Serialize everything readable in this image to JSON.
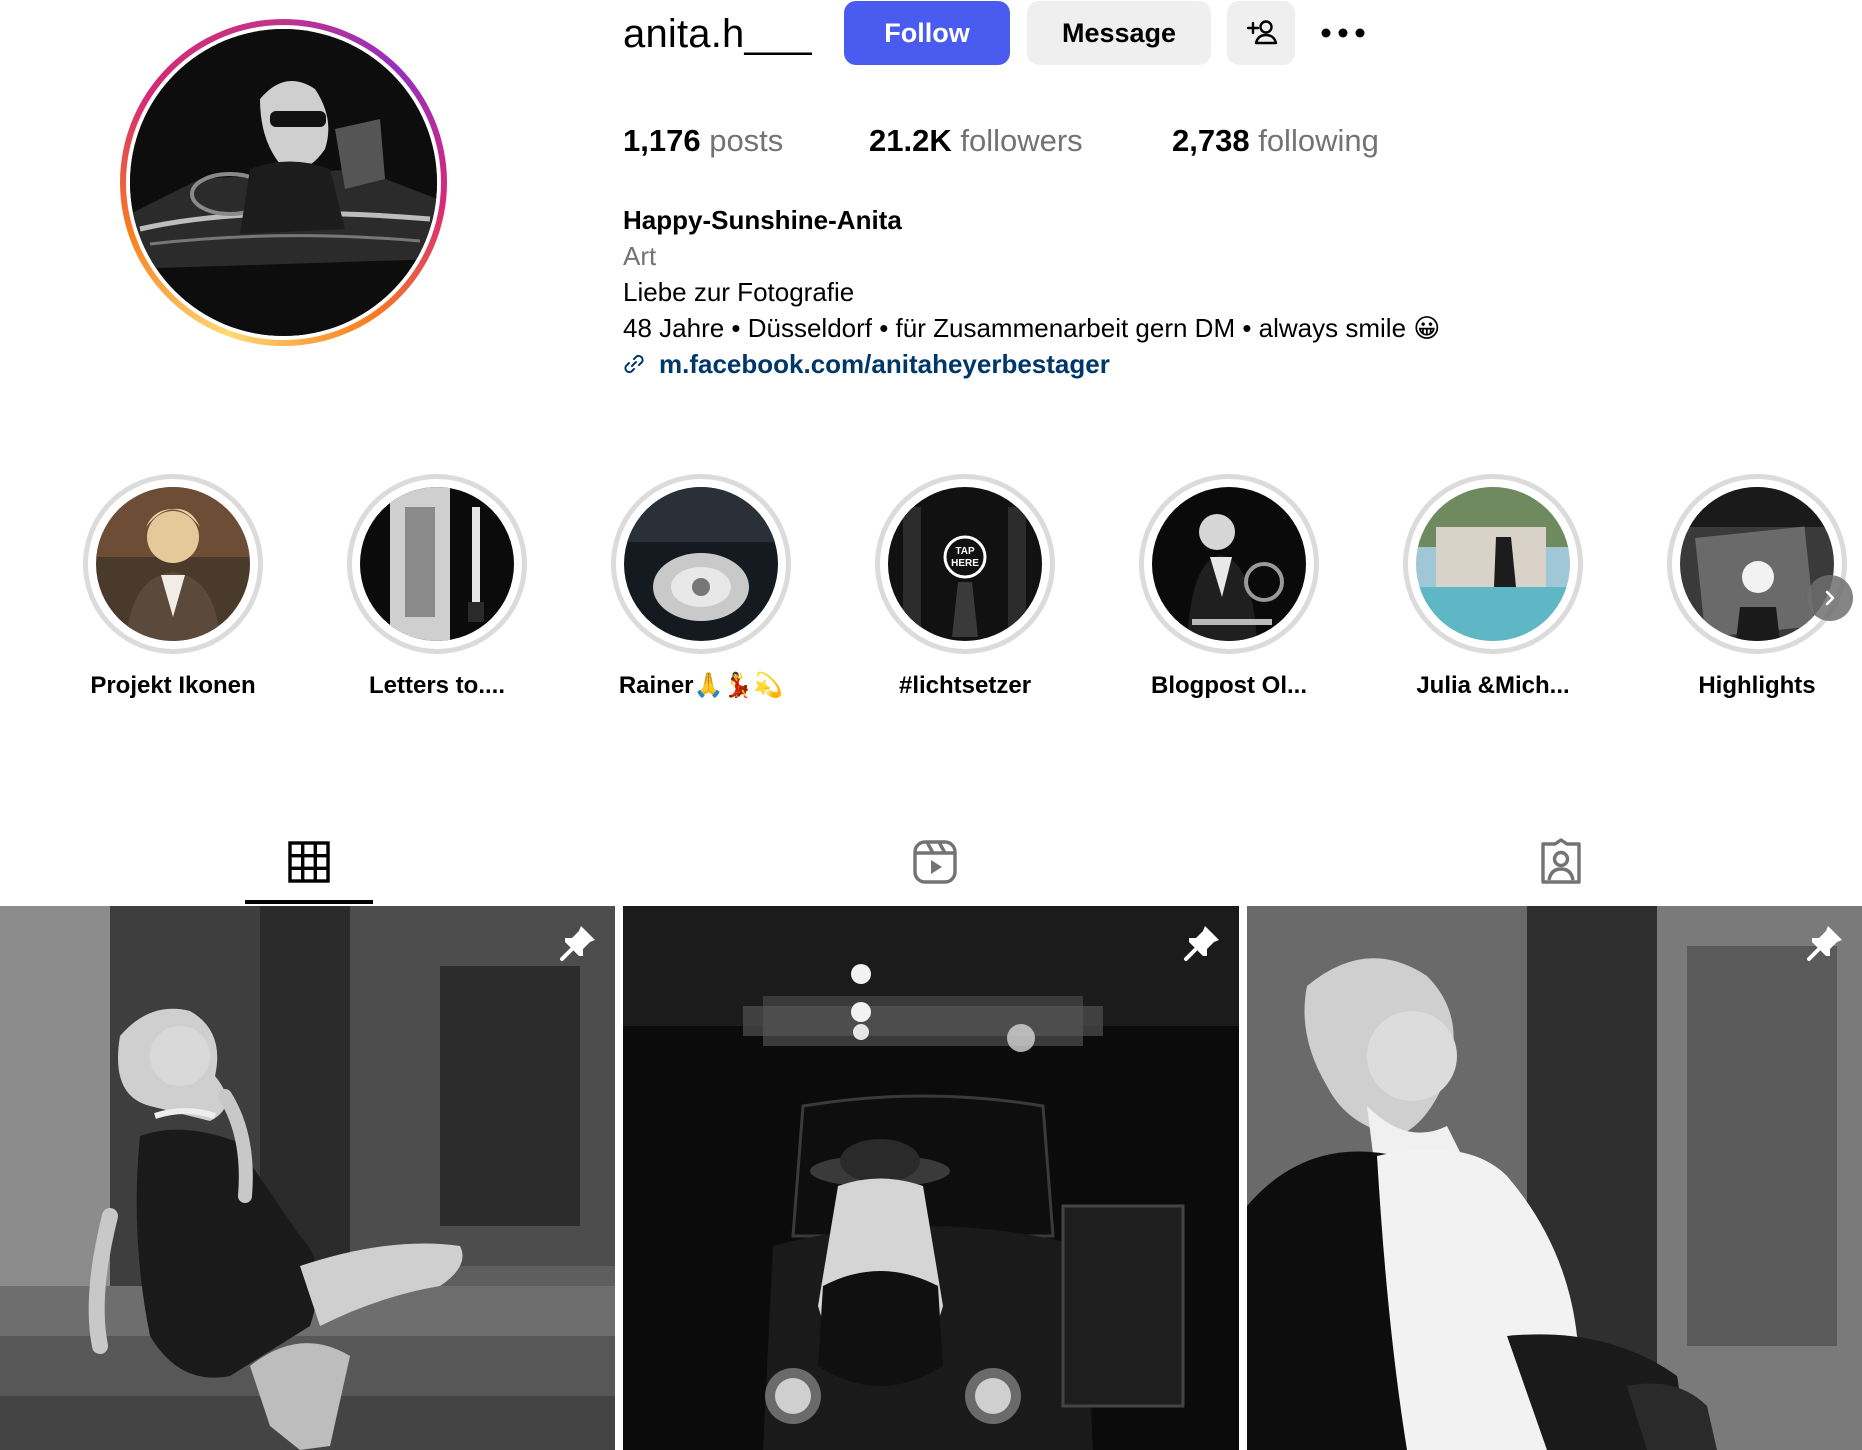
{
  "profile": {
    "username": "anita.h___",
    "follow_label": "Follow",
    "message_label": "Message"
  },
  "stats": {
    "posts_count": "1,176",
    "posts_label": "posts",
    "followers_count": "21.2K",
    "followers_label": "followers",
    "following_count": "2,738",
    "following_label": "following"
  },
  "bio": {
    "name": "Happy-Sunshine-Anita",
    "category": "Art",
    "line1": "Liebe zur Fotografie",
    "line2": "48 Jahre • Düsseldorf • für Zusammenarbeit gern DM • always smile 😀",
    "link": "m.facebook.com/anitaheyerbestager"
  },
  "highlights": [
    {
      "label": "Projekt Ikonen"
    },
    {
      "label": "Letters to...."
    },
    {
      "label": "Rainer🙏💃💫"
    },
    {
      "label": "#lichtsetzer"
    },
    {
      "label": "Blogpost Ol..."
    },
    {
      "label": "Julia &Mich..."
    },
    {
      "label": "Highlights"
    }
  ],
  "tabs": [
    {
      "name": "posts-tab",
      "icon": "grid-icon",
      "active": true
    },
    {
      "name": "reels-tab",
      "icon": "reels-icon",
      "active": false
    },
    {
      "name": "tagged-tab",
      "icon": "tagged-icon",
      "active": false
    }
  ],
  "posts": [
    {
      "pinned": true,
      "icon": "pin-icon"
    },
    {
      "pinned": true,
      "icon": "pin-icon"
    },
    {
      "pinned": true,
      "icon": "pin-icon"
    }
  ],
  "colors": {
    "accent": "#4a5cf0",
    "secondary_button": "#efefef",
    "muted_text": "#737373",
    "link": "#00376b"
  }
}
